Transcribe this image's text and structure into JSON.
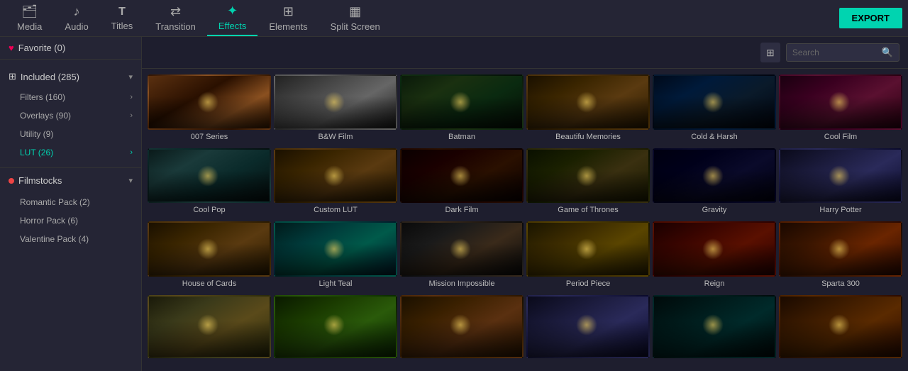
{
  "nav": {
    "items": [
      {
        "id": "media",
        "label": "Media",
        "icon": "🗂",
        "active": false
      },
      {
        "id": "audio",
        "label": "Audio",
        "icon": "♪",
        "active": false
      },
      {
        "id": "titles",
        "label": "Titles",
        "icon": "T",
        "active": false
      },
      {
        "id": "transition",
        "label": "Transition",
        "icon": "↔",
        "active": false
      },
      {
        "id": "effects",
        "label": "Effects",
        "icon": "✦",
        "active": true
      },
      {
        "id": "elements",
        "label": "Elements",
        "icon": "⊞",
        "active": false
      },
      {
        "id": "splitscreen",
        "label": "Split Screen",
        "icon": "▦",
        "active": false
      }
    ],
    "export_label": "EXPORT"
  },
  "sidebar": {
    "favorite_label": "Favorite (0)",
    "included_label": "Included (285)",
    "sub_items": [
      {
        "label": "Filters (160)",
        "highlight": false
      },
      {
        "label": "Overlays (90)",
        "highlight": false
      },
      {
        "label": "Utility (9)",
        "highlight": false
      },
      {
        "label": "LUT (26)",
        "highlight": true
      }
    ],
    "filmstocks_label": "Filmstocks",
    "filmstocks_items": [
      {
        "label": "Romantic Pack (2)"
      },
      {
        "label": "Horror Pack (6)"
      },
      {
        "label": "Valentine Pack (4)"
      }
    ]
  },
  "toolbar": {
    "search_placeholder": "Search"
  },
  "effects": [
    {
      "id": "007",
      "label": "007 Series",
      "thumb": "t-007"
    },
    {
      "id": "bw",
      "label": "B&W Film",
      "thumb": "t-bw"
    },
    {
      "id": "batman",
      "label": "Batman",
      "thumb": "t-batman"
    },
    {
      "id": "beautiful",
      "label": "Beautifu Memories",
      "thumb": "t-beauti"
    },
    {
      "id": "cold",
      "label": "Cold & Harsh",
      "thumb": "t-cold"
    },
    {
      "id": "coolfilm",
      "label": "Cool Film",
      "thumb": "t-coolf"
    },
    {
      "id": "coolpop",
      "label": "Cool Pop",
      "thumb": "t-coolp"
    },
    {
      "id": "custom",
      "label": "Custom LUT",
      "thumb": "t-custom"
    },
    {
      "id": "dark",
      "label": "Dark Film",
      "thumb": "t-dark"
    },
    {
      "id": "got",
      "label": "Game of Thrones",
      "thumb": "t-got"
    },
    {
      "id": "gravity",
      "label": "Gravity",
      "thumb": "t-grav"
    },
    {
      "id": "harry",
      "label": "Harry Potter",
      "thumb": "t-harry"
    },
    {
      "id": "house",
      "label": "House of Cards",
      "thumb": "t-house"
    },
    {
      "id": "lteal",
      "label": "Light Teal",
      "thumb": "t-lteal"
    },
    {
      "id": "mission",
      "label": "Mission Impossible",
      "thumb": "t-mission"
    },
    {
      "id": "period",
      "label": "Period Piece",
      "thumb": "t-period"
    },
    {
      "id": "reign",
      "label": "Reign",
      "thumb": "t-reign"
    },
    {
      "id": "sparta",
      "label": "Sparta 300",
      "thumb": "t-sparta"
    },
    {
      "id": "bot1",
      "label": "",
      "thumb": "t-bottom1"
    },
    {
      "id": "bot2",
      "label": "",
      "thumb": "t-bottom2"
    },
    {
      "id": "bot3",
      "label": "",
      "thumb": "t-bottom3"
    },
    {
      "id": "bot4",
      "label": "",
      "thumb": "t-bottom4"
    },
    {
      "id": "bot5",
      "label": "",
      "thumb": "t-bottom5"
    },
    {
      "id": "bot6",
      "label": "",
      "thumb": "t-bottom6"
    }
  ]
}
